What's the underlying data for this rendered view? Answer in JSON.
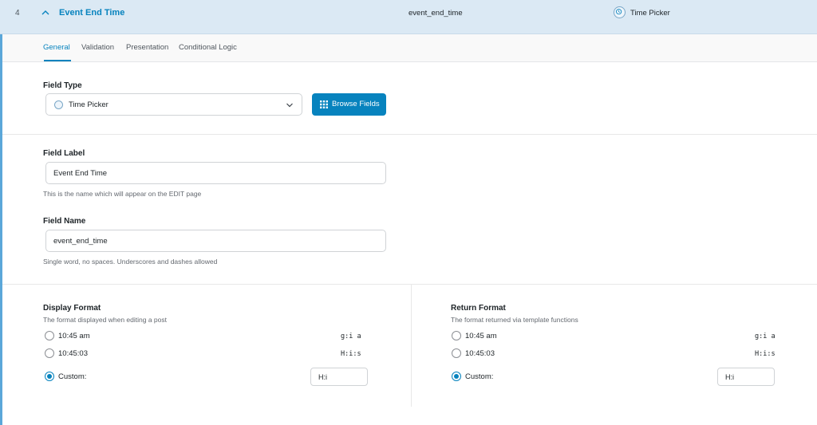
{
  "header": {
    "order": "4",
    "title": "Event End Time",
    "key": "event_end_time",
    "type_label": "Time Picker",
    "type_icon": "clock-icon",
    "collapse_icon": "chevron-up-icon"
  },
  "tabs": [
    {
      "label": "General",
      "active": true
    },
    {
      "label": "Validation",
      "active": false
    },
    {
      "label": "Presentation",
      "active": false
    },
    {
      "label": "Conditional Logic",
      "active": false
    }
  ],
  "field_type": {
    "label": "Field Type",
    "selected": "Time Picker",
    "browse_label": "Browse Fields"
  },
  "field_label": {
    "label": "Field Label",
    "value": "Event End Time",
    "description": "This is the name which will appear on the EDIT page"
  },
  "field_name": {
    "label": "Field Name",
    "value": "event_end_time",
    "description": "Single word, no spaces. Underscores and dashes allowed"
  },
  "display_format": {
    "label": "Display Format",
    "description": "The format displayed when editing a post",
    "options": [
      {
        "label": "10:45 am",
        "code": "g:i a",
        "checked": false
      },
      {
        "label": "10:45:03",
        "code": "H:i:s",
        "checked": false
      },
      {
        "label": "Custom:",
        "code": "",
        "checked": true
      }
    ],
    "custom_value": "H:i"
  },
  "return_format": {
    "label": "Return Format",
    "description": "The format returned via template functions",
    "options": [
      {
        "label": "10:45 am",
        "code": "g:i a",
        "checked": false
      },
      {
        "label": "10:45:03",
        "code": "H:i:s",
        "checked": false
      },
      {
        "label": "Custom:",
        "code": "",
        "checked": true
      }
    ],
    "custom_value": "H:i"
  },
  "colors": {
    "accent": "#0783be",
    "header_bg": "#dbe9f4"
  }
}
